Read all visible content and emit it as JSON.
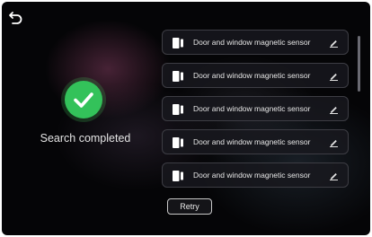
{
  "header": {
    "back_icon": "back-arrow-icon"
  },
  "status": {
    "icon": "checkmark-icon",
    "icon_color": "#33c25a",
    "text": "Search completed"
  },
  "devices": [
    {
      "name": "Door and window magnetic sensor",
      "icon": "door-sensor-icon",
      "action_icon": "edit-icon"
    },
    {
      "name": "Door and window magnetic sensor",
      "icon": "door-sensor-icon",
      "action_icon": "edit-icon"
    },
    {
      "name": "Door and window magnetic sensor",
      "icon": "door-sensor-icon",
      "action_icon": "edit-icon"
    },
    {
      "name": "Door and window magnetic sensor",
      "icon": "door-sensor-icon",
      "action_icon": "edit-icon"
    },
    {
      "name": "Door and window magnetic sensor",
      "icon": "door-sensor-icon",
      "action_icon": "edit-icon"
    }
  ],
  "actions": {
    "retry_label": "Retry"
  }
}
